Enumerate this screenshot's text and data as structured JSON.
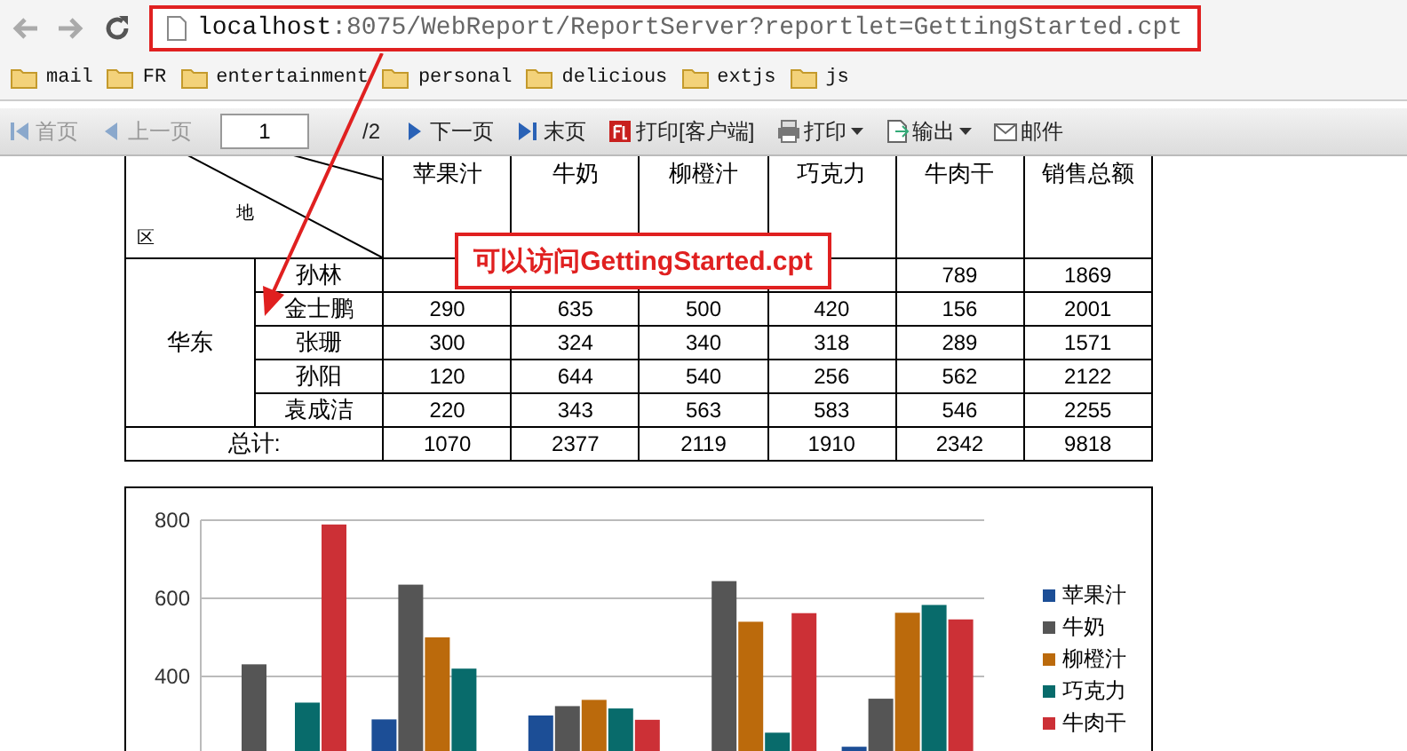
{
  "browser": {
    "url_host": "localhost",
    "url_rest": ":8075/WebReport/ReportServer?reportlet=GettingStarted.cpt",
    "highlighted": true
  },
  "bookmarks": [
    "mail",
    "FR",
    "entertainment",
    "personal",
    "delicious",
    "extjs",
    "js"
  ],
  "toolbar": [
    {
      "kind": "button",
      "label": "首页",
      "disabled": true
    },
    {
      "kind": "button",
      "label": "上一页",
      "disabled": true
    },
    {
      "kind": "page",
      "value": "1",
      "total": "/2"
    },
    {
      "kind": "button",
      "label": "下一页",
      "disabled": false
    },
    {
      "kind": "button",
      "label": "末页",
      "disabled": false
    },
    {
      "kind": "button",
      "label": "打印[客户端]",
      "disabled": false
    },
    {
      "kind": "menu",
      "label": "打印",
      "disabled": false
    },
    {
      "kind": "menu",
      "label": "输出",
      "disabled": false
    },
    {
      "kind": "button",
      "label": "邮件",
      "disabled": false
    }
  ],
  "table": {
    "corner": [
      "地",
      "区"
    ],
    "columns": [
      "苹果汁",
      "牛奶",
      "柳橙汁",
      "巧克力",
      "牛肉干",
      "销售总额"
    ],
    "region": "华东",
    "rows": [
      {
        "name": "孙林",
        "cells": [
          null,
          null,
          null,
          null,
          "789",
          "1869"
        ]
      },
      {
        "name": "金士鹏",
        "cells": [
          "290",
          "635",
          "500",
          "420",
          "156",
          "2001"
        ]
      },
      {
        "name": "张珊",
        "cells": [
          "300",
          "324",
          "340",
          "318",
          "289",
          "1571"
        ]
      },
      {
        "name": "孙阳",
        "cells": [
          "120",
          "644",
          "540",
          "256",
          "562",
          "2122"
        ]
      },
      {
        "name": "袁成洁",
        "cells": [
          "220",
          "343",
          "563",
          "583",
          "546",
          "2255"
        ]
      }
    ],
    "total": {
      "label": "总计:",
      "cells": [
        "1070",
        "2377",
        "2119",
        "1910",
        "2342",
        "9818"
      ]
    }
  },
  "callout": "可以访问GettingStarted.cpt",
  "chart_data": {
    "type": "bar",
    "ylim": [
      200,
      800
    ],
    "yticks": [
      400,
      600,
      800
    ],
    "grid": true,
    "series": [
      {
        "name": "苹果汁",
        "color": "#1c4e96",
        "values": [
          null,
          290,
          300,
          null,
          220
        ]
      },
      {
        "name": "牛奶",
        "color": "#555555",
        "values": [
          431,
          635,
          324,
          644,
          343
        ]
      },
      {
        "name": "柳橙汁",
        "color": "#bb6a0c",
        "values": [
          null,
          500,
          340,
          540,
          563
        ]
      },
      {
        "name": "巧克力",
        "color": "#086b6b",
        "values": [
          333,
          420,
          318,
          256,
          583
        ]
      },
      {
        "name": "牛肉干",
        "color": "#cc3036",
        "values": [
          789,
          null,
          289,
          562,
          546
        ]
      }
    ]
  }
}
